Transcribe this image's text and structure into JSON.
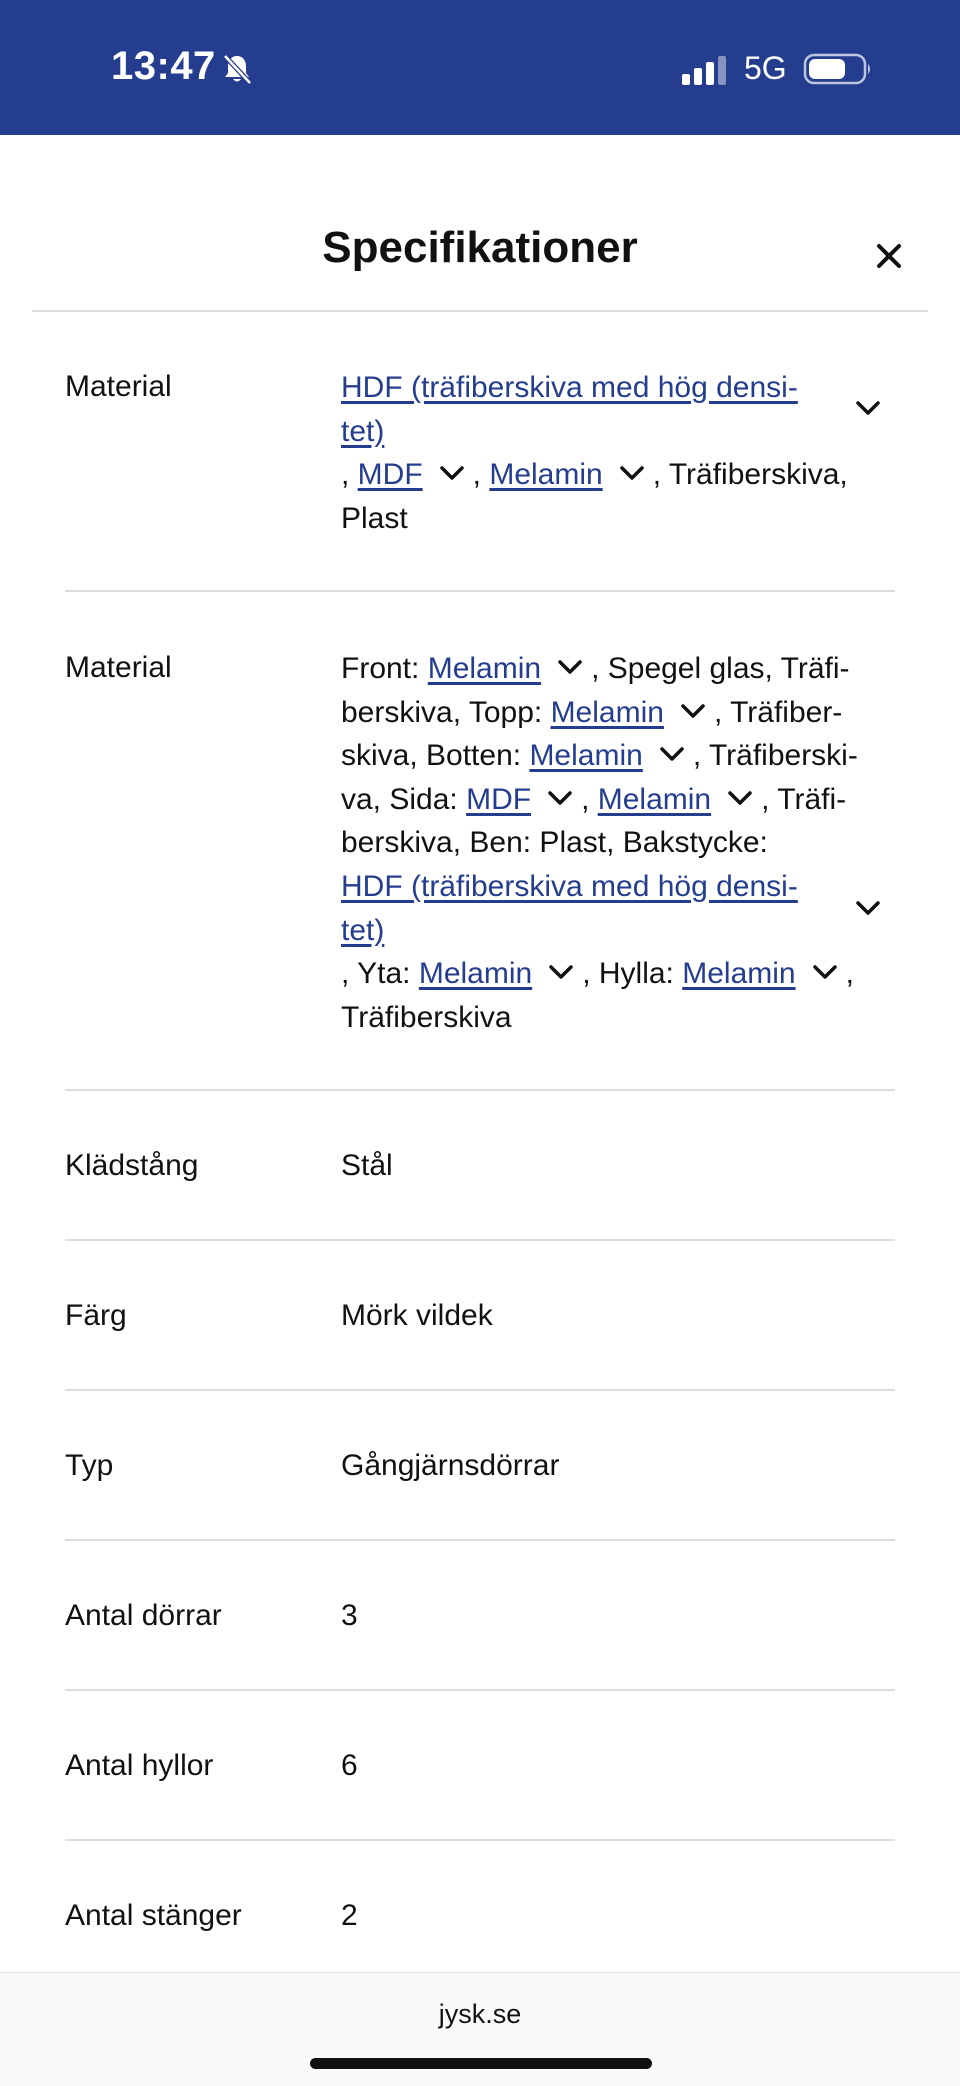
{
  "status_bar": {
    "time": "13:47",
    "network": "5G"
  },
  "sheet": {
    "title": "Specifikationer"
  },
  "specs": [
    {
      "label": "Material",
      "lines": [
        [
          "HDF (träfiberskiva med hög densi-"
        ],
        [
          "tet)"
        ],
        [
          ", ",
          "MDF",
          ", ",
          "Melamin",
          ", Träfiberskiva,"
        ],
        [
          "Plast"
        ]
      ]
    },
    {
      "label": "Material",
      "lines": [
        [
          "Front: ",
          "Melamin",
          ", Spegel glas, Träfi-"
        ],
        [
          "berskiva, Topp: ",
          "Melamin",
          ", Träfiber-"
        ],
        [
          "skiva, Botten: ",
          "Melamin",
          ", Träfiberski-"
        ],
        [
          "va, Sida: ",
          "MDF",
          ", ",
          "Melamin",
          ", Träfi-"
        ],
        [
          "berskiva, Ben: Plast, Bakstycke:"
        ],
        [
          "HDF (träfiberskiva med hög densi-"
        ],
        [
          "tet)"
        ],
        [
          ", Yta: ",
          "Melamin",
          ", Hylla: ",
          "Melamin",
          ","
        ],
        [
          "Träfiberskiva"
        ]
      ]
    },
    {
      "label": "Klädstång",
      "value": "Stål"
    },
    {
      "label": "Färg",
      "value": "Mörk vildek"
    },
    {
      "label": "Typ",
      "value": "Gångjärnsdörrar"
    },
    {
      "label": "Antal dörrar",
      "value": "3"
    },
    {
      "label": "Antal hyllor",
      "value": "6"
    },
    {
      "label": "Antal stänger",
      "value": "2"
    }
  ],
  "browser": {
    "url": "jysk.se"
  }
}
